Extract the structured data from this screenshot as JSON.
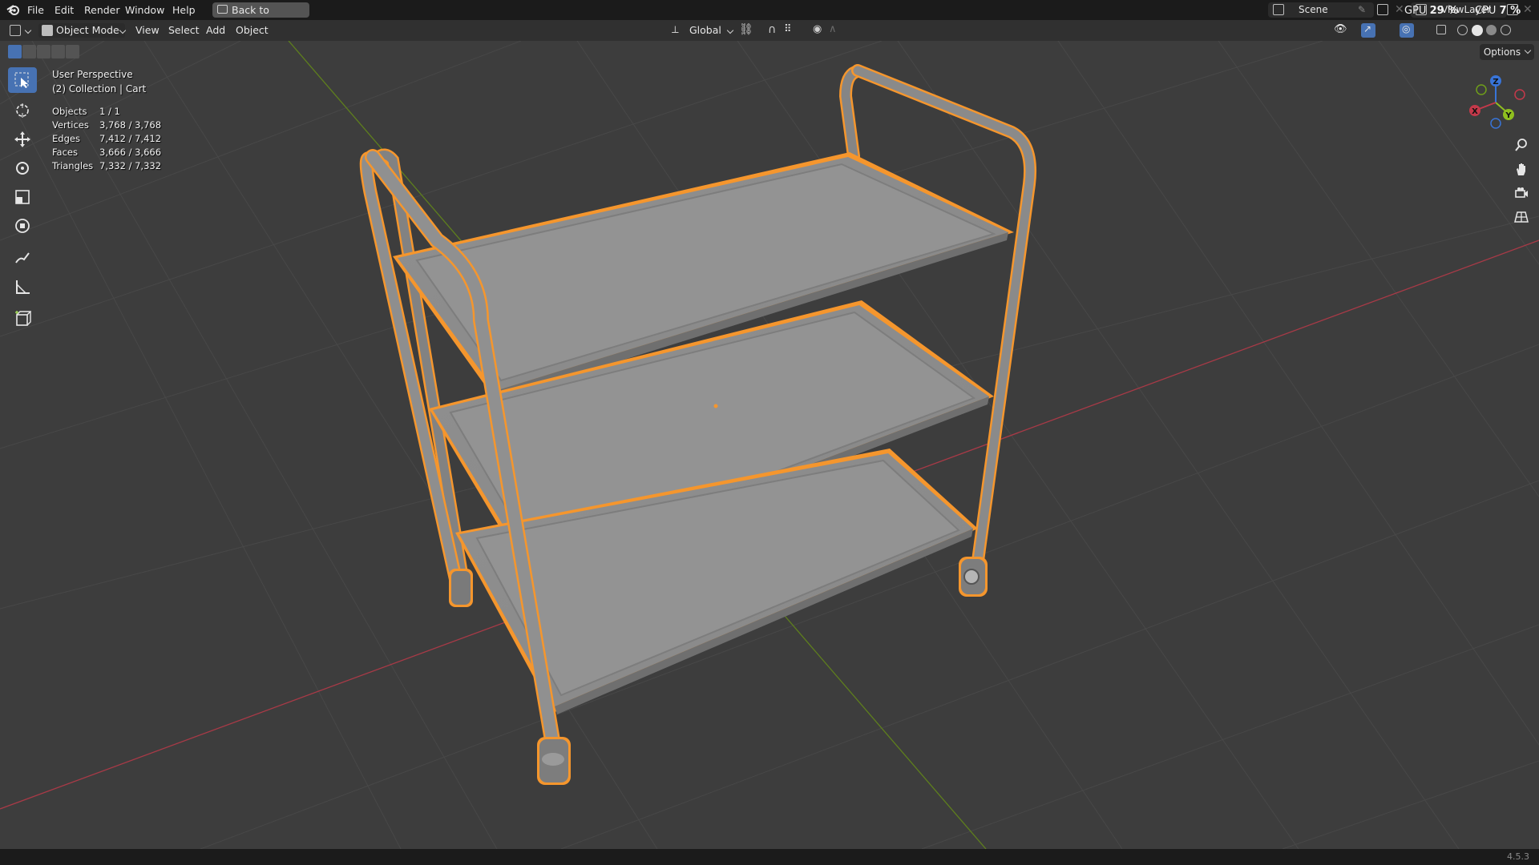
{
  "menu": {
    "items": [
      "File",
      "Edit",
      "Render",
      "Window",
      "Help"
    ],
    "back_button": "Back to Previous"
  },
  "workspace": {
    "scene_name": "Scene",
    "view_layer": "ViewLayer",
    "gpu_label": "GPU",
    "gpu_value": "29 %",
    "cpu_label": "CPU",
    "cpu_value": "7 %"
  },
  "header": {
    "mode": "Object Mode",
    "view": "View",
    "select": "Select",
    "add": "Add",
    "object": "Object",
    "orientation": "Global",
    "options": "Options"
  },
  "overlay": {
    "perspective": "User Perspective",
    "collection": "(2) Collection | Cart",
    "stats": [
      {
        "label": "Objects",
        "value": "1 / 1"
      },
      {
        "label": "Vertices",
        "value": "3,768 / 3,768"
      },
      {
        "label": "Edges",
        "value": "7,412 / 7,412"
      },
      {
        "label": "Faces",
        "value": "3,666 / 3,666"
      },
      {
        "label": "Triangles",
        "value": "7,332 / 7,332"
      }
    ]
  },
  "gizmo": {
    "x": "X",
    "y": "Y",
    "z": "Z"
  },
  "toolbar": {
    "tools": [
      "select-box",
      "cursor",
      "move",
      "rotate",
      "scale",
      "transform",
      "annotate",
      "measure",
      "add-cube"
    ],
    "active": "select-box"
  },
  "status": {
    "version": "4.5.3"
  },
  "colors": {
    "accent": "#4772b3",
    "selection_outline": "#f5962d",
    "axis_x": "#c4394a",
    "axis_y": "#6f9e1a",
    "axis_z": "#3874d8"
  }
}
